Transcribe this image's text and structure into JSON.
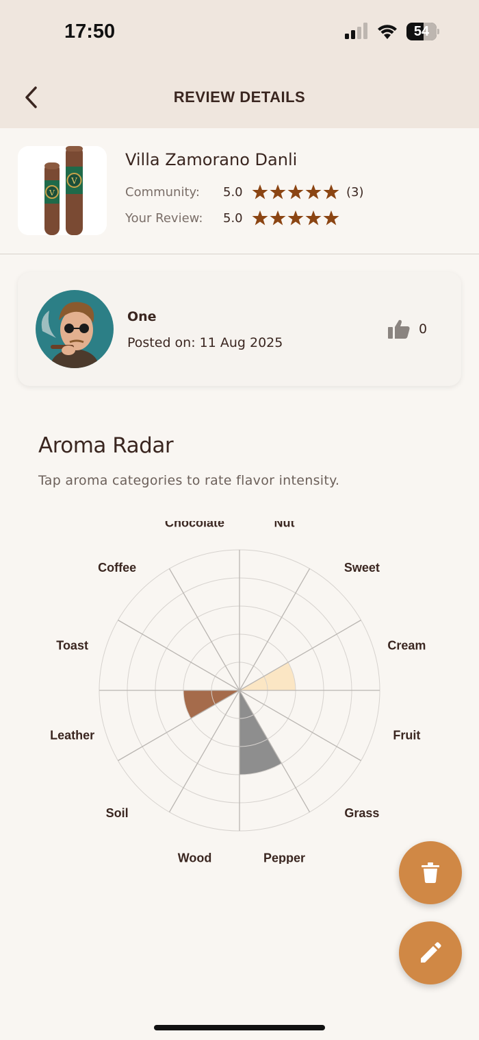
{
  "status": {
    "time": "17:50",
    "battery": "54"
  },
  "nav": {
    "title": "REVIEW DETAILS"
  },
  "product": {
    "name": "Villa Zamorano Danli",
    "community_label": "Community:",
    "community_rating": "5.0",
    "community_stars": 5,
    "community_count": "(3)",
    "your_label": "Your Review:",
    "your_rating": "5.0",
    "your_stars": 5
  },
  "review": {
    "reviewer": "One",
    "posted": "Posted on: 11 Aug 2025",
    "likes": "0"
  },
  "aroma": {
    "title": "Aroma Radar",
    "subtitle": "Tap aroma categories to rate flavor intensity.",
    "categories": [
      "Nut",
      "Sweet",
      "Cream",
      "Fruit",
      "Grass",
      "Pepper",
      "Wood",
      "Soil",
      "Leather",
      "Toast",
      "Coffee",
      "Chocolate"
    ],
    "max_level": 5,
    "ratings": [
      {
        "category": "Cream",
        "level": 2,
        "color": "#fbe6c4"
      },
      {
        "category": "Pepper",
        "level": 3,
        "color": "#8e8e8e"
      },
      {
        "category": "Leather",
        "level": 2,
        "color": "#a56b4b"
      }
    ]
  },
  "colors": {
    "accent": "#d08845",
    "star": "#8b4513",
    "background": "#f9f6f2",
    "header": "#efe6de"
  },
  "icons": {
    "back": "chevron-left-icon",
    "like": "thumbs-up-icon",
    "delete": "trash-icon",
    "edit": "pencil-icon"
  }
}
